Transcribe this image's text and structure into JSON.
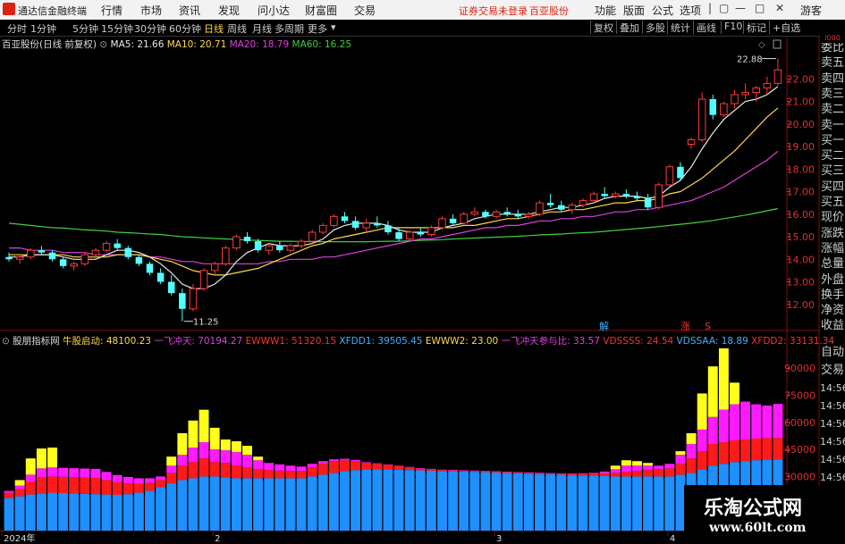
{
  "app": {
    "name": "通达信金融终端",
    "menus": [
      "行情",
      "市场",
      "资讯",
      "发现",
      "问小达",
      "财富圈",
      "交易"
    ],
    "notice": "证券交易未登录",
    "stock_name_top": "百亚股份",
    "right_menus": [
      "功能",
      "版面",
      "公式",
      "选项"
    ],
    "guest": "游客"
  },
  "period_tabs": [
    "分时",
    "1分钟",
    "5分钟",
    "15分钟",
    "30分钟",
    "60分钟",
    "日线",
    "周线",
    "月线",
    "多周期",
    "更多"
  ],
  "active_period": "日线",
  "right_tabs": [
    "复权",
    "叠加",
    "多股",
    "统计",
    "画线",
    "F10",
    "标记",
    "+自选"
  ],
  "chart_title": "百亚股份(日线 前复权)",
  "ma_legend": [
    {
      "label": "MA5: 21.66",
      "color": "#e8e8e8"
    },
    {
      "label": "MA10: 20.71",
      "color": "#ffd84a"
    },
    {
      "label": "MA20: 18.79",
      "color": "#e040e0"
    },
    {
      "label": "MA60: 16.25",
      "color": "#40d040"
    }
  ],
  "indicator_title": "股朋指标网",
  "indicator_legend": [
    {
      "label": "牛股启动: 48100.23",
      "color": "#ffd84a"
    },
    {
      "label": "一飞冲天: 70194.27",
      "color": "#e040e0"
    },
    {
      "label": "EWWW1: 51320.15",
      "color": "#ff3030"
    },
    {
      "label": "XFDD1: 39505.45",
      "color": "#40b0ff"
    },
    {
      "label": "EWWW2: 23.00",
      "color": "#ffd84a"
    },
    {
      "label": "一飞冲天参与比: 33.57",
      "color": "#e040e0"
    },
    {
      "label": "VDSSSS: 24.54",
      "color": "#ff3030"
    },
    {
      "label": "VDSSAA: 18.89",
      "color": "#40b0ff"
    },
    {
      "label": "XFDD2: 33131.34",
      "color": "#ff3030"
    }
  ],
  "annotations": {
    "high_label": "22.88",
    "low_label": "11.25",
    "marker_jie": "解",
    "marker_zhang": "涨",
    "marker_s": "S"
  },
  "price_axis": [
    "22.00",
    "21.00",
    "20.00",
    "19.00",
    "18.00",
    "17.00",
    "16.00",
    "15.00",
    "14.00",
    "13.00",
    "12.00"
  ],
  "vol_axis": [
    "90000",
    "75000",
    "60000",
    "45000",
    "30000"
  ],
  "date_axis": [
    "2024年",
    "2",
    "3",
    "4"
  ],
  "side_panel": [
    "委比",
    "卖五",
    "卖四",
    "卖三",
    "卖二",
    "卖一",
    "买一",
    "买二",
    "买三",
    "买四",
    "买五",
    "现价",
    "涨跌",
    "涨幅",
    "总量",
    "外盘",
    "换手",
    "净资",
    "收益"
  ],
  "side_panel_lower": [
    "自动",
    "交易",
    "14:56",
    "14:56",
    "14:56",
    "14:56",
    "14:56",
    "14:56",
    "14:56"
  ],
  "watermark": {
    "line1": "乐淘公式网",
    "line2": "www.60lt.com"
  },
  "colors": {
    "up": "#ff3b3b",
    "down": "#54ffff",
    "ma5": "#e8e8e8",
    "ma10": "#ffd84a",
    "ma20": "#e040e0",
    "ma60": "#40d040",
    "vol_blue": "#1e90ff",
    "vol_red": "#ff1a1a",
    "vol_magenta": "#ff1aff",
    "vol_yellow": "#ffff1a"
  },
  "chart_data": {
    "type": "candlestick",
    "ylim": [
      11.0,
      23.2
    ],
    "candles": [
      [
        14.1,
        14.3,
        13.9,
        14.0
      ],
      [
        14.0,
        14.2,
        13.8,
        14.1
      ],
      [
        14.1,
        14.5,
        14.0,
        14.4
      ],
      [
        14.4,
        14.6,
        14.2,
        14.3
      ],
      [
        14.3,
        14.4,
        13.9,
        14.0
      ],
      [
        14.0,
        14.1,
        13.6,
        13.7
      ],
      [
        13.7,
        13.9,
        13.5,
        13.8
      ],
      [
        13.8,
        14.3,
        13.7,
        14.2
      ],
      [
        14.2,
        14.5,
        14.0,
        14.4
      ],
      [
        14.4,
        14.8,
        14.3,
        14.7
      ],
      [
        14.7,
        14.9,
        14.4,
        14.5
      ],
      [
        14.5,
        14.6,
        14.0,
        14.1
      ],
      [
        14.1,
        14.2,
        13.7,
        13.8
      ],
      [
        13.8,
        13.9,
        13.3,
        13.4
      ],
      [
        13.4,
        13.6,
        12.9,
        13.0
      ],
      [
        13.0,
        13.3,
        12.4,
        12.5
      ],
      [
        12.5,
        12.7,
        11.25,
        11.8
      ],
      [
        11.8,
        12.9,
        11.7,
        12.7
      ],
      [
        12.7,
        13.6,
        12.6,
        13.5
      ],
      [
        13.5,
        13.9,
        13.3,
        13.8
      ],
      [
        13.8,
        14.6,
        13.7,
        14.5
      ],
      [
        14.5,
        15.1,
        14.4,
        15.0
      ],
      [
        15.0,
        15.2,
        14.7,
        14.8
      ],
      [
        14.8,
        14.9,
        14.3,
        14.4
      ],
      [
        14.4,
        14.7,
        14.2,
        14.6
      ],
      [
        14.6,
        14.8,
        14.3,
        14.4
      ],
      [
        14.4,
        14.7,
        14.3,
        14.6
      ],
      [
        14.6,
        14.9,
        14.5,
        14.8
      ],
      [
        14.8,
        15.3,
        14.7,
        15.2
      ],
      [
        15.2,
        15.6,
        15.1,
        15.5
      ],
      [
        15.5,
        16.0,
        15.4,
        15.9
      ],
      [
        15.9,
        16.1,
        15.6,
        15.7
      ],
      [
        15.7,
        15.9,
        15.3,
        15.4
      ],
      [
        15.4,
        15.8,
        15.2,
        15.6
      ],
      [
        15.6,
        15.9,
        15.4,
        15.5
      ],
      [
        15.5,
        15.7,
        15.1,
        15.2
      ],
      [
        15.2,
        15.4,
        14.8,
        14.9
      ],
      [
        14.9,
        15.3,
        14.8,
        15.2
      ],
      [
        15.2,
        15.4,
        15.0,
        15.1
      ],
      [
        15.1,
        15.5,
        15.0,
        15.4
      ],
      [
        15.4,
        15.9,
        15.3,
        15.8
      ],
      [
        15.8,
        16.0,
        15.5,
        15.6
      ],
      [
        15.6,
        16.1,
        15.5,
        16.0
      ],
      [
        16.0,
        16.3,
        15.9,
        16.1
      ],
      [
        16.1,
        16.2,
        15.8,
        15.9
      ],
      [
        15.9,
        16.2,
        15.8,
        16.1
      ],
      [
        16.1,
        16.3,
        15.9,
        16.0
      ],
      [
        16.0,
        16.2,
        15.8,
        15.9
      ],
      [
        15.9,
        16.1,
        15.8,
        16.0
      ],
      [
        16.0,
        16.6,
        15.9,
        16.5
      ],
      [
        16.5,
        16.9,
        16.3,
        16.4
      ],
      [
        16.4,
        16.6,
        16.1,
        16.2
      ],
      [
        16.2,
        16.5,
        16.0,
        16.4
      ],
      [
        16.4,
        16.7,
        16.3,
        16.6
      ],
      [
        16.6,
        17.0,
        16.5,
        16.9
      ],
      [
        16.9,
        17.2,
        16.7,
        16.8
      ],
      [
        16.8,
        17.0,
        16.7,
        16.9
      ],
      [
        16.9,
        17.1,
        16.7,
        16.8
      ],
      [
        16.8,
        17.0,
        16.6,
        16.7
      ],
      [
        16.7,
        16.9,
        16.2,
        16.3
      ],
      [
        16.3,
        17.4,
        16.2,
        17.3
      ],
      [
        17.3,
        18.2,
        17.2,
        18.1
      ],
      [
        18.1,
        18.3,
        17.5,
        17.6
      ],
      [
        19.1,
        19.4,
        18.9,
        19.3
      ],
      [
        19.3,
        21.4,
        19.2,
        21.1
      ],
      [
        21.1,
        21.3,
        20.2,
        20.4
      ],
      [
        20.4,
        21.0,
        20.3,
        20.9
      ],
      [
        20.9,
        21.5,
        20.7,
        21.3
      ],
      [
        21.3,
        21.8,
        21.1,
        21.4
      ],
      [
        21.4,
        21.7,
        21.0,
        21.6
      ],
      [
        21.6,
        22.1,
        21.3,
        21.8
      ],
      [
        21.8,
        22.9,
        21.7,
        22.4
      ]
    ],
    "ma5": [
      14.1,
      14.1,
      14.2,
      14.2,
      14.2,
      14.1,
      14.0,
      14.0,
      14.0,
      14.2,
      14.4,
      14.4,
      14.3,
      14.1,
      13.8,
      13.4,
      12.9,
      12.7,
      12.7,
      12.9,
      13.3,
      13.9,
      14.3,
      14.5,
      14.7,
      14.6,
      14.6,
      14.6,
      14.7,
      14.9,
      15.3,
      15.5,
      15.6,
      15.6,
      15.6,
      15.5,
      15.3,
      15.2,
      15.2,
      15.2,
      15.4,
      15.5,
      15.6,
      15.8,
      15.9,
      16.0,
      16.0,
      16.0,
      16.0,
      16.1,
      16.2,
      16.3,
      16.3,
      16.4,
      16.5,
      16.7,
      16.8,
      16.8,
      16.8,
      16.7,
      16.8,
      17.2,
      17.5,
      18.1,
      18.9,
      19.6,
      20.2,
      20.6,
      21.0,
      21.1,
      21.3,
      21.66
    ],
    "ma10": [
      14.2,
      14.2,
      14.2,
      14.2,
      14.2,
      14.2,
      14.1,
      14.1,
      14.1,
      14.1,
      14.2,
      14.2,
      14.2,
      14.1,
      14.0,
      13.9,
      13.7,
      13.5,
      13.4,
      13.3,
      13.3,
      13.4,
      13.5,
      13.6,
      13.8,
      14.0,
      14.2,
      14.4,
      14.6,
      14.7,
      14.9,
      15.0,
      15.1,
      15.2,
      15.3,
      15.4,
      15.4,
      15.4,
      15.4,
      15.4,
      15.4,
      15.4,
      15.5,
      15.5,
      15.6,
      15.7,
      15.8,
      15.8,
      15.9,
      16.0,
      16.1,
      16.1,
      16.2,
      16.2,
      16.3,
      16.4,
      16.5,
      16.5,
      16.6,
      16.6,
      16.7,
      16.9,
      17.0,
      17.3,
      17.6,
      18.0,
      18.4,
      18.8,
      19.3,
      19.8,
      20.3,
      20.71
    ],
    "ma20": [
      14.5,
      14.5,
      14.4,
      14.4,
      14.4,
      14.3,
      14.3,
      14.3,
      14.2,
      14.2,
      14.2,
      14.2,
      14.2,
      14.1,
      14.1,
      14.0,
      13.9,
      13.9,
      13.8,
      13.8,
      13.8,
      13.8,
      13.8,
      13.8,
      13.9,
      13.9,
      14.0,
      14.0,
      14.0,
      14.1,
      14.1,
      14.2,
      14.3,
      14.4,
      14.5,
      14.6,
      14.7,
      14.8,
      14.9,
      14.9,
      15.0,
      15.1,
      15.2,
      15.3,
      15.4,
      15.4,
      15.5,
      15.5,
      15.6,
      15.7,
      15.7,
      15.8,
      15.8,
      15.9,
      15.9,
      16.0,
      16.1,
      16.1,
      16.2,
      16.2,
      16.3,
      16.4,
      16.5,
      16.6,
      16.8,
      17.0,
      17.2,
      17.5,
      17.8,
      18.1,
      18.4,
      18.79
    ],
    "ma60": [
      15.6,
      15.55,
      15.5,
      15.45,
      15.4,
      15.38,
      15.35,
      15.3,
      15.28,
      15.25,
      15.2,
      15.18,
      15.15,
      15.12,
      15.1,
      15.05,
      15.0,
      14.98,
      14.95,
      14.92,
      14.9,
      14.88,
      14.85,
      14.84,
      14.82,
      14.8,
      14.8,
      14.79,
      14.78,
      14.78,
      14.78,
      14.78,
      14.78,
      14.78,
      14.79,
      14.8,
      14.8,
      14.82,
      14.84,
      14.85,
      14.87,
      14.9,
      14.92,
      14.94,
      14.96,
      14.98,
      15.0,
      15.02,
      15.05,
      15.08,
      15.1,
      15.12,
      15.15,
      15.18,
      15.2,
      15.24,
      15.28,
      15.32,
      15.36,
      15.4,
      15.45,
      15.5,
      15.55,
      15.6,
      15.66,
      15.72,
      15.8,
      15.88,
      15.96,
      16.05,
      16.15,
      16.25
    ],
    "indicator_ylim": [
      0,
      100000
    ],
    "indicator": {
      "blue": [
        18000,
        19000,
        20000,
        20500,
        21000,
        20800,
        20600,
        20400,
        20200,
        20000,
        19800,
        20200,
        21000,
        22000,
        24000,
        26000,
        28000,
        29000,
        30000,
        30000,
        29500,
        29000,
        29000,
        29000,
        29000,
        29000,
        29000,
        29000,
        30000,
        31000,
        32000,
        33000,
        33500,
        34000,
        34000,
        34000,
        33800,
        33600,
        33400,
        33200,
        33000,
        33000,
        32800,
        32600,
        32400,
        32200,
        32000,
        31800,
        31600,
        31400,
        31200,
        31000,
        30800,
        30600,
        30400,
        30200,
        30000,
        30000,
        30000,
        30000,
        30000,
        30000,
        31000,
        32000,
        34000,
        36000,
        37000,
        38000,
        38500,
        39000,
        39300,
        39505
      ],
      "red": [
        3000,
        4000,
        7000,
        9000,
        9000,
        9000,
        9000,
        9000,
        9000,
        8000,
        7000,
        6000,
        5000,
        4500,
        4000,
        6000,
        8000,
        9000,
        10000,
        8000,
        8000,
        7000,
        6000,
        5000,
        4500,
        4200,
        4000,
        4000,
        5000,
        6000,
        6500,
        6000,
        5000,
        3500,
        3000,
        2500,
        2000,
        1500,
        1000,
        800,
        600,
        500,
        500,
        500,
        500,
        500,
        500,
        500,
        500,
        500,
        500,
        500,
        600,
        800,
        1000,
        1500,
        2000,
        2500,
        3000,
        3500,
        4000,
        4500,
        6000,
        8000,
        10000,
        12000,
        12000,
        12000,
        12000,
        12000,
        12000,
        11815
      ],
      "magenta": [
        1000,
        2000,
        4000,
        5000,
        5000,
        5000,
        5000,
        5000,
        5000,
        4500,
        4000,
        3500,
        3000,
        2500,
        2000,
        4000,
        6000,
        8000,
        9000,
        7000,
        7000,
        7500,
        7000,
        5000,
        4000,
        3500,
        3000,
        2500,
        2000,
        1500,
        1000,
        800,
        600,
        400,
        300,
        200,
        200,
        200,
        200,
        200,
        200,
        200,
        200,
        200,
        200,
        200,
        200,
        200,
        200,
        200,
        200,
        200,
        300,
        400,
        600,
        1000,
        2000,
        3500,
        3000,
        2500,
        2000,
        2500,
        5000,
        8000,
        12000,
        15000,
        18000,
        20000,
        21000,
        19000,
        18000,
        18874
      ],
      "yellow": [
        0,
        3000,
        9000,
        11000,
        11000,
        0,
        0,
        0,
        0,
        0,
        0,
        0,
        0,
        0,
        0,
        5000,
        12000,
        15000,
        18000,
        12000,
        6000,
        6000,
        5000,
        2000,
        0,
        0,
        0,
        0,
        0,
        0,
        0,
        0,
        0,
        0,
        0,
        0,
        0,
        0,
        0,
        0,
        0,
        0,
        0,
        0,
        0,
        0,
        0,
        0,
        0,
        0,
        0,
        0,
        0,
        0,
        0,
        0,
        2000,
        3000,
        2500,
        1500,
        0,
        0,
        2000,
        6000,
        20000,
        28000,
        34000,
        12000,
        0,
        0,
        0,
        0
      ]
    }
  }
}
